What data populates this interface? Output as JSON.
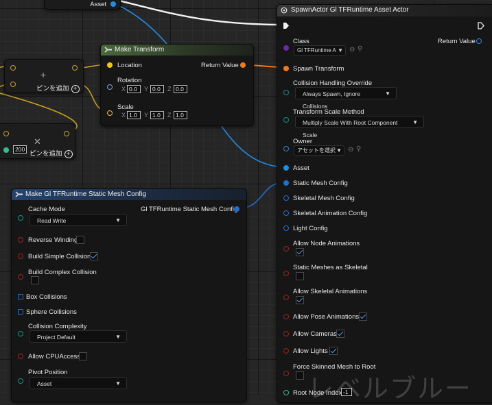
{
  "top_stub": {
    "asset_label": "Asset"
  },
  "add_pin_nodes": [
    {
      "add_pin_label": "ピンを追加"
    },
    {
      "value": "200",
      "add_pin_label": "ピンを追加"
    }
  ],
  "make_transform": {
    "title": "Make Transform",
    "location_label": "Location",
    "rotation_label": "Rotation",
    "scale_label": "Scale",
    "return_label": "Return Value",
    "rotation": {
      "x": "0.0",
      "y": "0.0",
      "z": "0.0"
    },
    "scale": {
      "x": "1.0",
      "y": "1.0",
      "z": "1.0"
    },
    "axis": {
      "x": "X",
      "y": "Y",
      "z": "Z"
    }
  },
  "make_config": {
    "title": "Make Gl TFRuntime Static Mesh Config",
    "output_label": "Gl TFRuntime Static Mesh Config",
    "cache_mode_label": "Cache Mode",
    "cache_mode_value": "Read Write",
    "reverse_winding_label": "Reverse Winding",
    "build_simple_label": "Build Simple Collision",
    "build_complex_label": "Build Complex Collision",
    "box_collisions_label": "Box Collisions",
    "sphere_collisions_label": "Sphere Collisions",
    "complexity_label": "Collision Complexity",
    "complexity_value": "Project Default",
    "allow_cpu_label": "Allow CPUAccess",
    "pivot_label": "Pivot Position",
    "pivot_value": "Asset"
  },
  "spawn_actor": {
    "title": "SpawnActor Gl TFRuntime Asset Actor",
    "class_label": "Class",
    "class_value": "Gl TFRuntime A",
    "return_label": "Return Value",
    "spawn_transform_label": "Spawn Transform",
    "collision_override_label": "Collision Handling Override",
    "collision_override_value": "Always Spawn, Ignore Collisions",
    "scale_method_label": "Transform Scale Method",
    "scale_method_value": "Multiply Scale With Root Component Scale",
    "owner_label": "Owner",
    "owner_value": "アセットを選択",
    "asset_label": "Asset",
    "static_mesh_label": "Static Mesh Config",
    "skeletal_mesh_label": "Skeletal Mesh Config",
    "skeletal_anim_label": "Skeletal Animation Config",
    "light_config_label": "Light Config",
    "allow_node_anim_label": "Allow Node Animations",
    "static_as_skeletal_label": "Static Meshes as Skeletal",
    "allow_skeletal_anim_label": "Allow Skeletal Animations",
    "allow_pose_anim_label": "Allow Pose Animations",
    "allow_cameras_label": "Allow Cameras",
    "allow_lights_label": "Allow Lights",
    "force_skinned_label": "Force Skinned Mesh to Root",
    "root_node_label": "Root Node Index",
    "root_node_value": "-1"
  },
  "watermark": "レベルブルー"
}
